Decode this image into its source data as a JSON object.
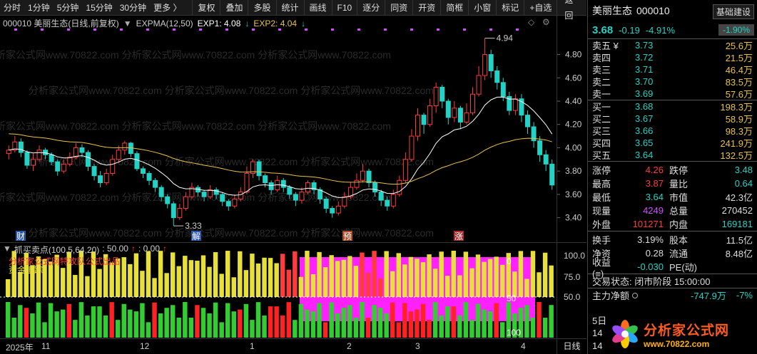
{
  "toolbar": {
    "periods": [
      "分时",
      "1分钟",
      "5分钟",
      "15分钟",
      "30分钟",
      "更多 〉"
    ],
    "tools": [
      "复权",
      "叠加",
      "多股",
      "统计",
      "画线",
      "F10",
      "逐分",
      "同资",
      "开资",
      "简框",
      "小窗",
      "标记",
      "+自选"
    ],
    "back": "返回"
  },
  "chart": {
    "title": "000010 美丽生态(日线,前复权)",
    "indicator": "EXPMA(12,50)",
    "exp1_label": "EXP1: 4.08",
    "exp2_label": "EXP2: 4.04",
    "y_ticks": [
      "4.80",
      "4.60",
      "4.40",
      "4.20",
      "4.00",
      "3.80",
      "3.60",
      "3.40"
    ],
    "high_label": "4.94",
    "low_label": "3.33",
    "event_labels": [
      "财",
      "解",
      "预",
      "涨"
    ],
    "watermark": "分析家公式网www.70822.com"
  },
  "subchart": {
    "title": "抓买卖点(100,5,64,20)",
    "value1": ": 50.00",
    "value2": ": 0.00",
    "y_ticks": [
      "100.0",
      "75.0",
      "50.0"
    ],
    "inner_ticks": [
      "0",
      "50",
      "100"
    ],
    "legend_lines": [
      "分析家公式网特攻队公式出品",
      "资金追踪"
    ]
  },
  "date_axis": {
    "labels": [
      "2025年",
      "11",
      "12",
      "1",
      "2",
      "3",
      "4"
    ],
    "period": "日线"
  },
  "chart_data": {
    "type": "candlestick",
    "title": "000010 美丽生态(日线,前复权)",
    "ylim": [
      3.3,
      4.95
    ],
    "x_labels": [
      "2025年",
      "11",
      "12",
      "1",
      "2",
      "3",
      "4"
    ],
    "high": 4.94,
    "low": 3.33,
    "series": [
      {
        "name": "EXP1",
        "last": 4.08
      },
      {
        "name": "EXP2",
        "last": 4.04
      }
    ],
    "candles": [
      [
        3.95,
        3.98,
        4.02,
        3.9
      ],
      [
        3.98,
        4.05,
        4.1,
        3.96
      ],
      [
        4.05,
        3.96,
        4.08,
        3.92
      ],
      [
        3.96,
        3.85,
        3.98,
        3.82
      ],
      [
        3.85,
        3.9,
        3.95,
        3.8
      ],
      [
        3.9,
        3.98,
        4.02,
        3.88
      ],
      [
        3.98,
        3.94,
        4.0,
        3.9
      ],
      [
        3.94,
        3.88,
        3.96,
        3.85
      ],
      [
        3.88,
        3.8,
        3.9,
        3.76
      ],
      [
        3.8,
        3.86,
        3.9,
        3.78
      ],
      [
        3.86,
        3.92,
        3.96,
        3.84
      ],
      [
        3.92,
        4.0,
        4.04,
        3.9
      ],
      [
        4.0,
        3.96,
        4.03,
        3.92
      ],
      [
        3.96,
        3.84,
        3.98,
        3.8
      ],
      [
        3.84,
        3.76,
        3.86,
        3.72
      ],
      [
        3.76,
        3.7,
        3.8,
        3.66
      ],
      [
        3.7,
        3.78,
        3.82,
        3.68
      ],
      [
        3.78,
        3.9,
        3.94,
        3.76
      ],
      [
        3.9,
        3.98,
        4.02,
        3.88
      ],
      [
        3.98,
        4.04,
        4.06,
        3.94
      ],
      [
        4.04,
        3.95,
        4.05,
        3.92
      ],
      [
        3.95,
        3.82,
        3.97,
        3.8
      ],
      [
        3.82,
        3.78,
        3.84,
        3.74
      ],
      [
        3.78,
        3.72,
        3.8,
        3.68
      ],
      [
        3.72,
        3.66,
        3.74,
        3.62
      ],
      [
        3.66,
        3.58,
        3.68,
        3.54
      ],
      [
        3.58,
        3.52,
        3.6,
        3.48
      ],
      [
        3.52,
        3.4,
        3.54,
        3.33
      ],
      [
        3.4,
        3.48,
        3.52,
        3.38
      ],
      [
        3.48,
        3.58,
        3.62,
        3.46
      ],
      [
        3.58,
        3.66,
        3.7,
        3.56
      ],
      [
        3.66,
        3.62,
        3.68,
        3.58
      ],
      [
        3.62,
        3.58,
        3.64,
        3.54
      ],
      [
        3.58,
        3.64,
        3.68,
        3.56
      ],
      [
        3.64,
        3.6,
        3.66,
        3.56
      ],
      [
        3.6,
        3.54,
        3.62,
        3.5
      ],
      [
        3.54,
        3.5,
        3.56,
        3.46
      ],
      [
        3.5,
        3.56,
        3.6,
        3.48
      ],
      [
        3.56,
        3.62,
        3.66,
        3.54
      ],
      [
        3.62,
        3.78,
        3.84,
        3.6
      ],
      [
        3.78,
        3.88,
        3.9,
        3.74
      ],
      [
        3.88,
        3.76,
        3.9,
        3.72
      ],
      [
        3.76,
        3.7,
        3.78,
        3.66
      ],
      [
        3.7,
        3.64,
        3.72,
        3.6
      ],
      [
        3.64,
        3.72,
        3.76,
        3.62
      ],
      [
        3.72,
        3.66,
        3.74,
        3.62
      ],
      [
        3.66,
        3.6,
        3.68,
        3.56
      ],
      [
        3.6,
        3.55,
        3.62,
        3.5
      ],
      [
        3.55,
        3.62,
        3.66,
        3.52
      ],
      [
        3.62,
        3.7,
        3.72,
        3.6
      ],
      [
        3.7,
        3.64,
        3.72,
        3.6
      ],
      [
        3.64,
        3.56,
        3.66,
        3.52
      ],
      [
        3.56,
        3.48,
        3.58,
        3.44
      ],
      [
        3.48,
        3.44,
        3.5,
        3.4
      ],
      [
        3.44,
        3.5,
        3.54,
        3.42
      ],
      [
        3.5,
        3.58,
        3.62,
        3.48
      ],
      [
        3.58,
        3.66,
        3.7,
        3.56
      ],
      [
        3.66,
        3.72,
        3.78,
        3.64
      ],
      [
        3.72,
        3.8,
        3.86,
        3.7
      ],
      [
        3.8,
        3.7,
        3.82,
        3.66
      ],
      [
        3.7,
        3.62,
        3.72,
        3.58
      ],
      [
        3.62,
        3.55,
        3.64,
        3.5
      ],
      [
        3.55,
        3.5,
        3.58,
        3.46
      ],
      [
        3.5,
        3.6,
        3.64,
        3.48
      ],
      [
        3.6,
        3.72,
        3.76,
        3.58
      ],
      [
        3.72,
        3.9,
        3.96,
        3.7
      ],
      [
        3.9,
        4.1,
        4.16,
        3.88
      ],
      [
        4.1,
        4.28,
        4.34,
        4.06
      ],
      [
        4.28,
        4.2,
        4.3,
        4.12
      ],
      [
        4.2,
        4.36,
        4.42,
        4.18
      ],
      [
        4.36,
        4.52,
        4.56,
        4.3
      ],
      [
        4.52,
        4.4,
        4.54,
        4.34
      ],
      [
        4.4,
        4.26,
        4.42,
        4.2
      ],
      [
        4.26,
        4.34,
        4.4,
        4.22
      ],
      [
        4.34,
        4.22,
        4.36,
        4.16
      ],
      [
        4.22,
        4.3,
        4.38,
        4.2
      ],
      [
        4.3,
        4.46,
        4.52,
        4.28
      ],
      [
        4.46,
        4.62,
        4.7,
        4.44
      ],
      [
        4.62,
        4.8,
        4.94,
        4.58
      ],
      [
        4.8,
        4.66,
        4.84,
        4.6
      ],
      [
        4.66,
        4.56,
        4.7,
        4.5
      ],
      [
        4.56,
        4.44,
        4.6,
        4.4
      ],
      [
        4.44,
        4.32,
        4.48,
        4.28
      ],
      [
        4.32,
        4.42,
        4.46,
        4.28
      ],
      [
        4.42,
        4.28,
        4.46,
        4.22
      ],
      [
        4.28,
        4.18,
        4.32,
        4.12
      ],
      [
        4.18,
        4.06,
        4.22,
        4.0
      ],
      [
        4.06,
        3.94,
        4.1,
        3.88
      ],
      [
        3.94,
        3.86,
        3.98,
        3.8
      ],
      [
        3.86,
        3.68,
        3.9,
        3.64
      ]
    ]
  },
  "quote": {
    "name": "美丽生态",
    "code": "000010",
    "button": "基础建设",
    "price": "3.68",
    "change": "-0.19",
    "change_pct": "-4.91%",
    "sector_pct": "-1.90%",
    "asks": [
      {
        "label": "卖五 ¥",
        "price": "3.73",
        "vol": "25.6万"
      },
      {
        "label": "卖四",
        "price": "3.72",
        "vol": "21.5万"
      },
      {
        "label": "卖三",
        "price": "3.71",
        "vol": "46.4万"
      },
      {
        "label": "卖二",
        "price": "3.70",
        "vol": "83.5万"
      },
      {
        "label": "卖一",
        "price": "3.69",
        "vol": "57.6万"
      }
    ],
    "bids": [
      {
        "label": "买一",
        "price": "3.68",
        "vol": "198.3万"
      },
      {
        "label": "买二",
        "price": "3.67",
        "vol": "58.9万"
      },
      {
        "label": "买三",
        "price": "3.66",
        "vol": "98.3万"
      },
      {
        "label": "买四",
        "price": "3.65",
        "vol": "241.9万"
      },
      {
        "label": "买五",
        "price": "3.64",
        "vol": "132.5万"
      }
    ],
    "stats1": [
      {
        "k1": "涨停",
        "v1": "4.26",
        "k2": "跌停",
        "v2": "3.48"
      },
      {
        "k1": "最高",
        "v1": "3.87",
        "k2": "量比",
        "v2": "0.64"
      },
      {
        "k1": "最低",
        "v1": "3.64",
        "k2": "市值",
        "v2": "42.3亿"
      },
      {
        "k1": "现量",
        "v1": "4249",
        "k2": "总量",
        "v2": "270452"
      },
      {
        "k1": "外盘",
        "v1": "101271",
        "k2": "内盘",
        "v2": "169181"
      }
    ],
    "stats2": [
      {
        "k1": "换手",
        "v1": "3.19%",
        "k2": "股本",
        "v2": "11.5亿"
      },
      {
        "k1": "净资",
        "v1": "0.28",
        "k2": "流通",
        "v2": "8.48亿"
      },
      {
        "k1": "收益(≡)",
        "v1": "-0.030",
        "k2": "PE(动)",
        "v2": ""
      }
    ],
    "status": "交易状态: 闭市阶段 15:00:00",
    "flow_label": "主力净额",
    "flow_value": "-747.9万",
    "flow_pct": "-7%",
    "stub1": "5日",
    "stub2": "14",
    "stub3": "14"
  },
  "logo": {
    "title": "分析家公式网",
    "url": "www.70822.com"
  }
}
